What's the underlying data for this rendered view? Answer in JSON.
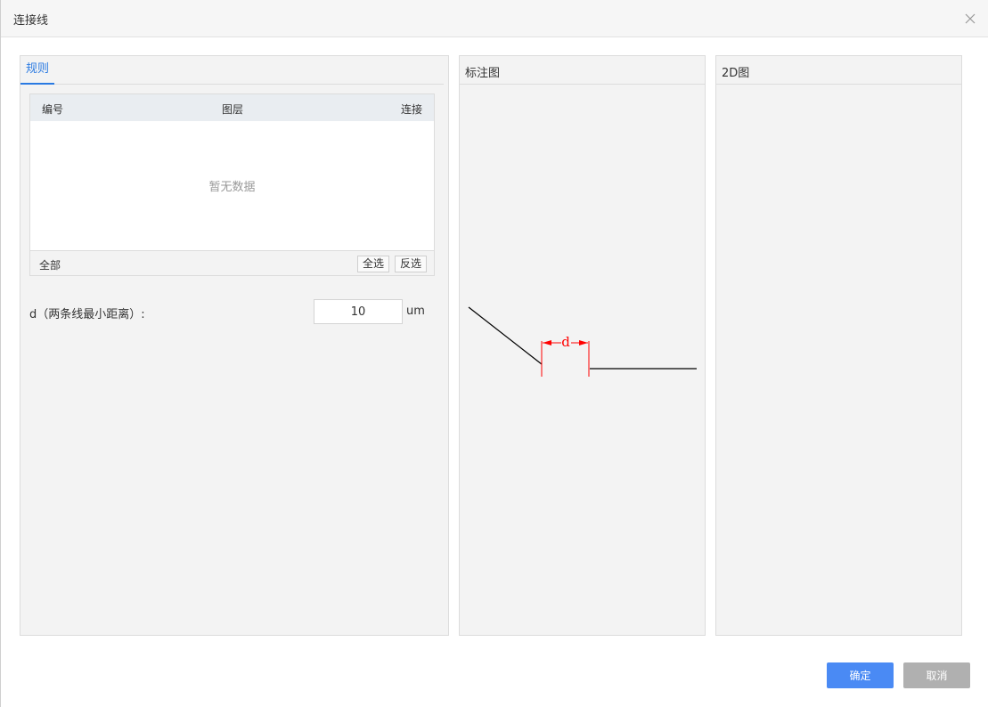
{
  "dialog": {
    "title": "连接线",
    "close_icon": "close-icon"
  },
  "rules_panel": {
    "tab_label": "规则",
    "table": {
      "columns": [
        "编号",
        "图层",
        "连接"
      ],
      "empty_text": "暂无数据",
      "footer_label": "全部",
      "select_all_label": "全选",
      "invert_label": "反选"
    },
    "param": {
      "label": "d（两条线最小距离）:",
      "value": "10",
      "unit": "um"
    }
  },
  "annotation_panel": {
    "title": "标注图",
    "dimension_label": "d",
    "dimension_color": "#ff0000"
  },
  "view2d_panel": {
    "title": "2D图"
  },
  "buttons": {
    "ok_label": "确定",
    "cancel_label": "取消",
    "ok_color": "#4a8af4",
    "cancel_color": "#b0b0b0"
  }
}
